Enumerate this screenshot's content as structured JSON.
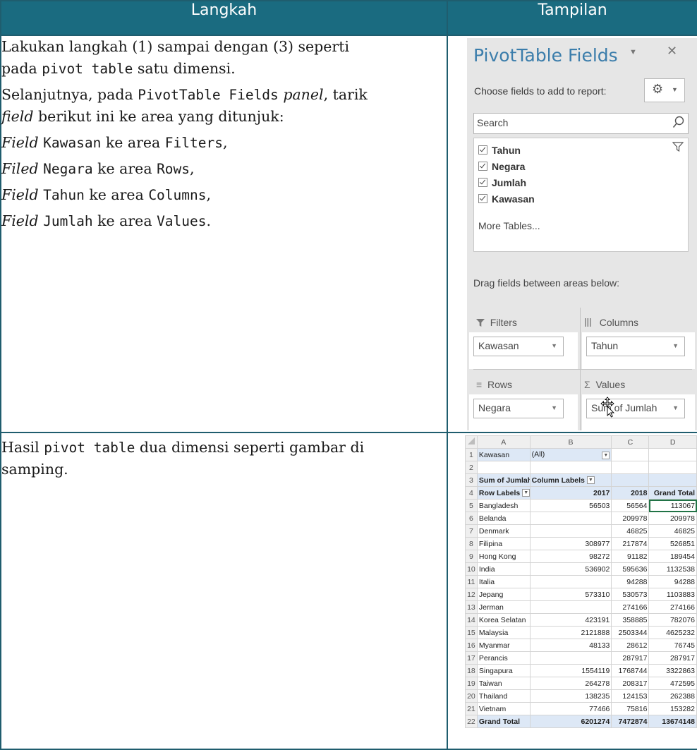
{
  "header": {
    "col1": "Langkah",
    "col2": "Tampilan"
  },
  "row1": {
    "p1a": "Lakukan langkah (1) sampai dengan (3) seperti",
    "p1b_pre": "pada ",
    "p1b_code": "pivot table",
    "p1b_post": " satu dimensi.",
    "p2a_pre": "Selanjutnya, pada ",
    "p2a_code": "PivotTable Fields",
    "p2a_it": "panel",
    "p2a_post": ", tarik",
    "p2b_it": "field",
    "p2b_post": " berikut ini ke area yang ditunjuk:",
    "f1_it": "Field",
    "f1_code1": "Kawasan",
    "f1_mid": " ke area ",
    "f1_code2": "Filters",
    "f1_end": ",",
    "f2_it": "Filed",
    "f2_code1": "Negara",
    "f2_mid": " ke area ",
    "f2_code2": "Rows",
    "f2_end": ",",
    "f3_it": "Field",
    "f3_code1": "Tahun",
    "f3_mid": " ke area ",
    "f3_code2": "Columns",
    "f3_end": ",",
    "f4_it": "Field",
    "f4_code1": "Jumlah",
    "f4_mid": " ke area ",
    "f4_code2": "Values",
    "f4_end": "."
  },
  "pivot_panel": {
    "title": "PivotTable Fields",
    "choose": "Choose fields to add to report:",
    "search_placeholder": "Search",
    "fields": [
      "Tahun",
      "Negara",
      "Jumlah",
      "Kawasan"
    ],
    "more_tables": "More Tables...",
    "drag_hint": "Drag fields between areas below:",
    "filters_label": "Filters",
    "columns_label": "Columns",
    "rows_label": "Rows",
    "values_label": "Values",
    "filters_value": "Kawasan",
    "columns_value": "Tahun",
    "rows_value": "Negara",
    "values_value": "Sum of Jumlah",
    "icons": [
      "dropdown-icon",
      "close-icon",
      "gear-icon",
      "search-icon",
      "filter-icon",
      "columns-icon",
      "rows-icon",
      "sigma-icon",
      "move-cursor-icon"
    ]
  },
  "row2": {
    "pre": "Hasil ",
    "code": "pivot table",
    "post": " dua dimensi seperti gambar di",
    "line2": "samping."
  },
  "excel": {
    "columns": [
      "A",
      "B",
      "C",
      "D"
    ],
    "r1_label": "Kawasan",
    "r1_value": "(All)",
    "r3_a": "Sum of Jumlah",
    "r3_b": "Column Labels",
    "r4_a": "Row Labels",
    "r4_b": "2017",
    "r4_c": "2018",
    "r4_d": "Grand Total",
    "rows": [
      [
        "Bangladesh",
        "56503",
        "56564",
        "113067"
      ],
      [
        "Belanda",
        "",
        "209978",
        "209978"
      ],
      [
        "Denmark",
        "",
        "46825",
        "46825"
      ],
      [
        "Filipina",
        "308977",
        "217874",
        "526851"
      ],
      [
        "Hong Kong",
        "98272",
        "91182",
        "189454"
      ],
      [
        "India",
        "536902",
        "595636",
        "1132538"
      ],
      [
        "Italia",
        "",
        "94288",
        "94288"
      ],
      [
        "Jepang",
        "573310",
        "530573",
        "1103883"
      ],
      [
        "Jerman",
        "",
        "274166",
        "274166"
      ],
      [
        "Korea Selatan",
        "423191",
        "358885",
        "782076"
      ],
      [
        "Malaysia",
        "2121888",
        "2503344",
        "4625232"
      ],
      [
        "Myanmar",
        "48133",
        "28612",
        "76745"
      ],
      [
        "Perancis",
        "",
        "287917",
        "287917"
      ],
      [
        "Singapura",
        "1554119",
        "1768744",
        "3322863"
      ],
      [
        "Taiwan",
        "264278",
        "208317",
        "472595"
      ],
      [
        "Thailand",
        "138235",
        "124153",
        "262388"
      ],
      [
        "Vietnam",
        "77466",
        "75816",
        "153282"
      ]
    ],
    "total": [
      "Grand Total",
      "6201274",
      "7472874",
      "13674148"
    ]
  }
}
